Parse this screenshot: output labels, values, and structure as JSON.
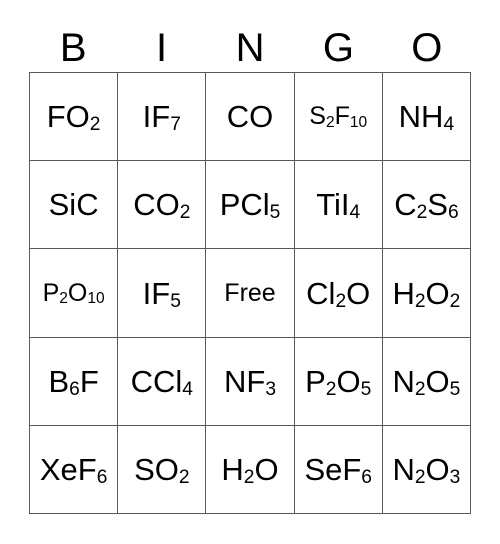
{
  "card": {
    "type": "bingo-card",
    "columns": 5,
    "rows": 5,
    "free_space": {
      "row": 3,
      "column": 3,
      "label": "Free"
    },
    "colors": {
      "background": "#ffffff",
      "text": "#000000",
      "grid_line": "#55585c"
    }
  },
  "header": {
    "letters": [
      "B",
      "I",
      "N",
      "G",
      "O"
    ]
  },
  "grid": {
    "rows": [
      [
        {
          "formula": "FO2",
          "display": "FO₂"
        },
        {
          "formula": "IF7",
          "display": "IF₇"
        },
        {
          "formula": "CO",
          "display": "CO"
        },
        {
          "formula": "S2F10",
          "display": "S₂F₁₀"
        },
        {
          "formula": "NH4",
          "display": "NH₄"
        }
      ],
      [
        {
          "formula": "SiC",
          "display": "SiC"
        },
        {
          "formula": "CO2",
          "display": "CO₂"
        },
        {
          "formula": "PCl5",
          "display": "PCl₅"
        },
        {
          "formula": "TiI4",
          "display": "TiI₄"
        },
        {
          "formula": "C2S6",
          "display": "C₂S₆"
        }
      ],
      [
        {
          "formula": "P2O10",
          "display": "P₂O₁₀"
        },
        {
          "formula": "IF5",
          "display": "IF₅"
        },
        {
          "formula": "Free",
          "display": "Free"
        },
        {
          "formula": "Cl2O",
          "display": "Cl₂O"
        },
        {
          "formula": "H2O2",
          "display": "H₂O₂"
        }
      ],
      [
        {
          "formula": "B6F",
          "display": "B₆F"
        },
        {
          "formula": "CCl4",
          "display": "CCl₄"
        },
        {
          "formula": "NF3",
          "display": "NF₃"
        },
        {
          "formula": "P2O5",
          "display": "P₂O₅"
        },
        {
          "formula": "N2O5",
          "display": "N₂O₅"
        }
      ],
      [
        {
          "formula": "XeF6",
          "display": "XeF₆"
        },
        {
          "formula": "SO2",
          "display": "SO₂"
        },
        {
          "formula": "H2O",
          "display": "H₂O"
        },
        {
          "formula": "SeF6",
          "display": "SeF₆"
        },
        {
          "formula": "N2O3",
          "display": "N₂O₃"
        }
      ]
    ]
  }
}
